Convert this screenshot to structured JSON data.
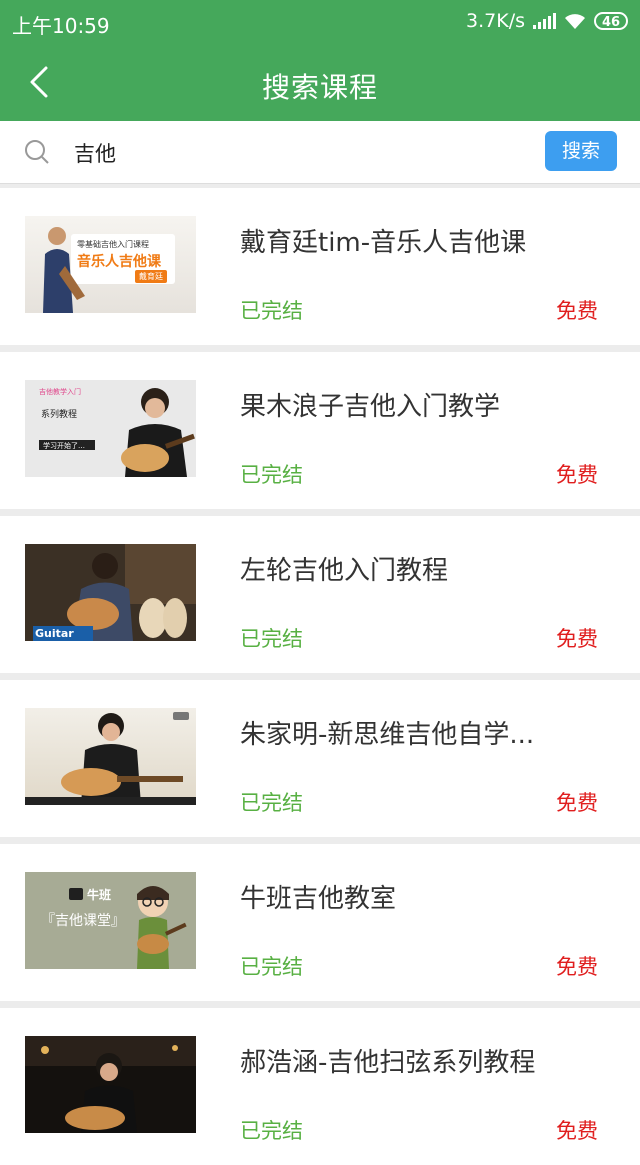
{
  "status_bar": {
    "time": "上午10:59",
    "net_speed": "3.7K/s",
    "battery": "46"
  },
  "header": {
    "title": "搜索课程"
  },
  "search": {
    "value": "吉他",
    "button_label": "搜索"
  },
  "colors": {
    "header_green": "#45a85b",
    "status_green": "#58b043",
    "price_red": "#e01e1e",
    "search_button_blue": "#3d9ef0"
  },
  "courses": [
    {
      "name": "戴育廷tim-音乐人吉他课",
      "status": "已完结",
      "price": "免费",
      "thumb": {
        "line1": "零基础吉他入门课程",
        "line2": "音乐人吉他课",
        "tag": "戴育廷"
      }
    },
    {
      "name": "果木浪子吉他入门教学",
      "status": "已完结",
      "price": "免费",
      "thumb": {
        "line1": "吉他教学入门",
        "line2": "系列教程",
        "line3": "学习开始了…"
      }
    },
    {
      "name": "左轮吉他入门教程",
      "status": "已完结",
      "price": "免费",
      "thumb": {
        "line1": "Guitar"
      }
    },
    {
      "name": "朱家明-新思维吉他自学...",
      "status": "已完结",
      "price": "免费",
      "thumb": {}
    },
    {
      "name": "牛班吉他教室",
      "status": "已完结",
      "price": "免费",
      "thumb": {
        "line1": "牛班",
        "line2": "『吉他课堂』"
      }
    },
    {
      "name": "郝浩涵-吉他扫弦系列教程",
      "status": "已完结",
      "price": "免费",
      "thumb": {}
    }
  ]
}
